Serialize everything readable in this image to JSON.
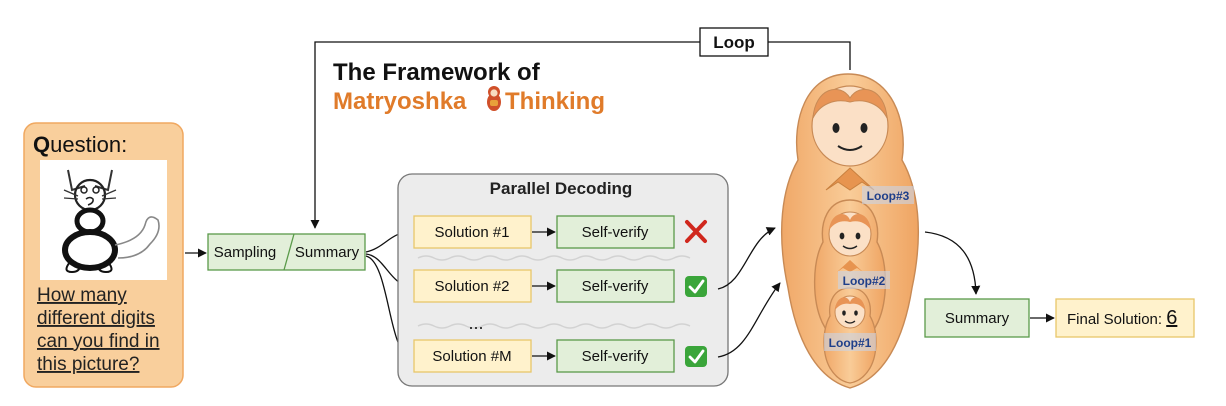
{
  "title": {
    "line1": "The Framework of",
    "line2a": "Matryoshka",
    "line2b": "Thinking"
  },
  "question": {
    "heading_bold": "Q",
    "heading_rest": "uestion:",
    "lines": [
      "How many",
      "different digits",
      "can you find in",
      "this picture?"
    ]
  },
  "sampling": {
    "left": "Sampling",
    "right": "Summary"
  },
  "parallel": {
    "title": "Parallel Decoding",
    "ellipsis": "..."
  },
  "rows": [
    {
      "solution": "Solution #1",
      "verify": "Self-verify",
      "result": "fail"
    },
    {
      "solution": "Solution #2",
      "verify": "Self-verify",
      "result": "pass"
    },
    {
      "solution": "Solution #M",
      "verify": "Self-verify",
      "result": "pass"
    }
  ],
  "loop": {
    "label": "Loop"
  },
  "dolls": {
    "labels": [
      "Loop#3",
      "Loop#2",
      "Loop#1"
    ]
  },
  "summary": {
    "label": "Summary"
  },
  "final": {
    "label": "Final Solution: ",
    "value": "6"
  },
  "colors": {
    "orange": "#e07b2a",
    "question_bg": "#f9cf9c",
    "question_border": "#f0a860",
    "green_fill": "#e2efd9",
    "green_border": "#5a9a4a",
    "yellow_fill": "#fff2cc",
    "yellow_border": "#e8c66a",
    "panel_fill": "#ececec",
    "doll_body": "#f6c088",
    "fail": "#d0271d",
    "pass": "#3aa53a"
  }
}
